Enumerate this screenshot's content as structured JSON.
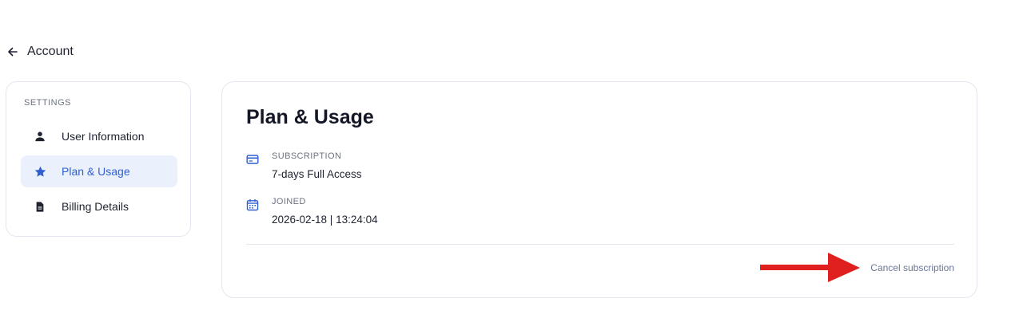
{
  "back": {
    "label": "Account",
    "icon": "arrow-left-icon"
  },
  "sidebar": {
    "heading": "SETTINGS",
    "items": [
      {
        "label": "User Information",
        "icon": "user-icon",
        "active": false
      },
      {
        "label": "Plan & Usage",
        "icon": "star-icon",
        "active": true
      },
      {
        "label": "Billing Details",
        "icon": "document-icon",
        "active": false
      }
    ]
  },
  "main": {
    "title": "Plan & Usage",
    "subscription": {
      "label": "SUBSCRIPTION",
      "value": "7-days Full Access",
      "icon": "credit-card-icon"
    },
    "joined": {
      "label": "JOINED",
      "value": "2026-02-18 | 13:24:04",
      "icon": "calendar-icon"
    },
    "cancel_label": "Cancel subscription"
  },
  "colors": {
    "accent": "#2f5fd0",
    "active_bg": "#eaf1fd",
    "annotation_arrow": "#e0201e",
    "border": "#e3e6ee"
  }
}
